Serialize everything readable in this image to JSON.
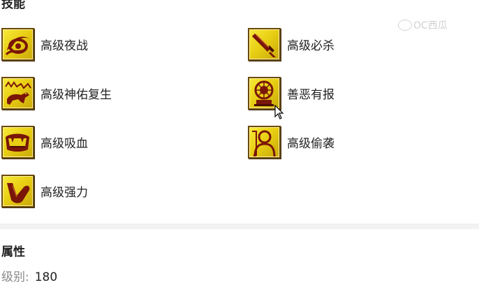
{
  "sections": {
    "skills_title": "技能",
    "attributes_title": "属性"
  },
  "skills": [
    {
      "label": "高级夜战",
      "icon": "eye-icon"
    },
    {
      "label": "高级必杀",
      "icon": "sword-icon"
    },
    {
      "label": "高级神佑复生",
      "icon": "wolf-icon"
    },
    {
      "label": "善恶有报",
      "icon": "shrine-icon"
    },
    {
      "label": "高级吸血",
      "icon": "fang-mouth-icon"
    },
    {
      "label": "高级偷袭",
      "icon": "shadow-figure-icon"
    },
    {
      "label": "高级强力",
      "icon": "flexed-arm-icon"
    }
  ],
  "attributes": {
    "level_label": "级别:",
    "level_value": "180"
  },
  "watermark": {
    "text": "OC西瓜"
  },
  "colors": {
    "icon_gold": "#e9cf14",
    "icon_dark": "#6b1a0a",
    "divider": "#f2f2f2"
  }
}
